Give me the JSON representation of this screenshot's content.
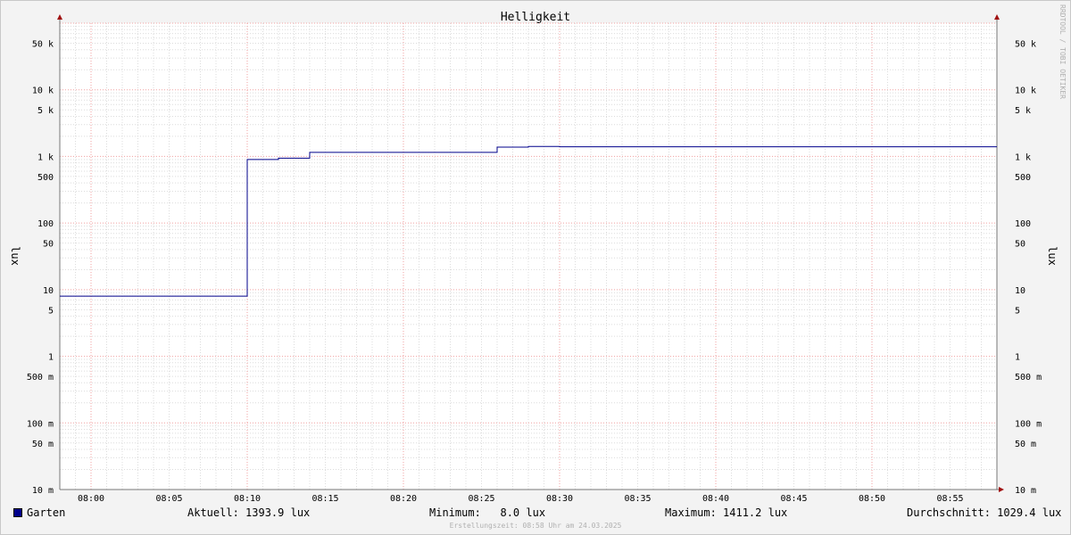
{
  "chart_data": {
    "type": "line",
    "title": "Helligkeit",
    "ylabel": "lux",
    "yscale": "log",
    "ylim": [
      0.01,
      100000
    ],
    "y_ticks": [
      {
        "value": 50000,
        "label": "50 k"
      },
      {
        "value": 10000,
        "label": "10 k"
      },
      {
        "value": 5000,
        "label": "5 k"
      },
      {
        "value": 1000,
        "label": "1 k"
      },
      {
        "value": 500,
        "label": "500"
      },
      {
        "value": 100,
        "label": "100"
      },
      {
        "value": 50,
        "label": "50"
      },
      {
        "value": 10,
        "label": "10"
      },
      {
        "value": 5,
        "label": "5"
      },
      {
        "value": 1,
        "label": "1"
      },
      {
        "value": 0.5,
        "label": "500 m"
      },
      {
        "value": 0.1,
        "label": "100 m"
      },
      {
        "value": 0.05,
        "label": "50 m"
      },
      {
        "value": 0.01,
        "label": "10 m"
      }
    ],
    "x_ticks": [
      "08:00",
      "08:05",
      "08:10",
      "08:15",
      "08:20",
      "08:25",
      "08:30",
      "08:35",
      "08:40",
      "08:45",
      "08:50",
      "08:55"
    ],
    "xlim": [
      "07:58",
      "08:58"
    ],
    "grid": true,
    "series": [
      {
        "name": "Garten",
        "color": "#00008b",
        "step": true,
        "points": [
          [
            "07:58",
            8.0
          ],
          [
            "08:10",
            900
          ],
          [
            "08:12",
            940
          ],
          [
            "08:14",
            1150
          ],
          [
            "08:26",
            1380
          ],
          [
            "08:28",
            1411.2
          ],
          [
            "08:30",
            1393.9
          ],
          [
            "08:58",
            1393.9
          ]
        ]
      }
    ]
  },
  "legend": {
    "series_name": "Garten",
    "current": "Aktuell: 1393.9 lux",
    "minimum": "Minimum:   8.0 lux",
    "maximum": "Maximum: 1411.2 lux",
    "average": "Durchschnitt: 1029.4 lux"
  },
  "footer": "Erstellungszeit: 08:58 Uhr am 24.03.2025",
  "watermark": "RRDTOOL / TOBI OETIKER"
}
